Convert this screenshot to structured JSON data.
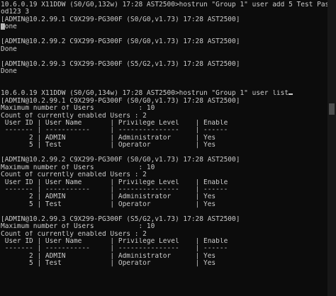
{
  "terminal": {
    "lines": [
      "10.6.0.19 X11DDW (S0/G0,132w) 17:28 AST2500>hostrun \"Group 1\" user add 5 Test Passw",
      "od123 3",
      "[ADMIN@10.2.99.1 C9X299-PG300F (S0/G0,v1.73) 17:28 AST2500]",
      "Done",
      "",
      "[ADMIN@10.2.99.2 C9X299-PG300F (S0/G0,v1.73) 17:28 AST2500]",
      "Done",
      "",
      "[ADMIN@10.2.99.3 C9X299-PG300F (S5/G2,v1.73) 17:28 AST2500]",
      "Done",
      "",
      "",
      "10.6.0.19 X11DDW (S0/G0,134w) 17:28 AST2500>hostrun \"Group 1\" user list",
      "[ADMIN@10.2.99.1 C9X299-PG300F (S0/G0,v1.73) 17:28 AST2500]",
      "Maximum number of Users           : 10",
      "Count of currently enabled Users : 2",
      " User ID | User Name       | Privilege Level    | Enable",
      " ------- | -----------     | ---------------    | ------",
      "       2 | ADMIN           | Administrator      | Yes",
      "       5 | Test            | Operator           | Yes",
      "",
      "[ADMIN@10.2.99.2 C9X299-PG300F (S0/G0,v1.73) 17:28 AST2500]",
      "Maximum number of Users           : 10",
      "Count of currently enabled Users : 2",
      " User ID | User Name       | Privilege Level    | Enable",
      " ------- | -----------     | ---------------    | ------",
      "       2 | ADMIN           | Administrator      | Yes",
      "       5 | Test            | Operator           | Yes",
      "",
      "[ADMIN@10.2.99.3 C9X299-PG300F (S5/G2,v1.73) 17:28 AST2500]",
      "Maximum number of Users           : 10",
      "Count of currently enabled Users : 2",
      " User ID | User Name       | Privilege Level    | Enable",
      " ------- | -----------     | ---------------    | ------",
      "       2 | ADMIN           | Administrator      | Yes",
      "       5 | Test            | Operator           | Yes"
    ],
    "block_cursor_line": 3,
    "under_cursor_line": 12,
    "colors": {
      "background": "#0c0c0c",
      "foreground": "#cccccc",
      "scrollbar_track": "#171717",
      "scrollbar_thumb": "#4d4d4d"
    }
  }
}
